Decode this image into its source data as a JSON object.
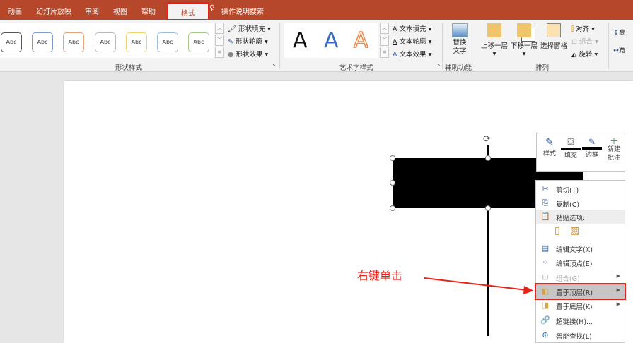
{
  "tabs": [
    "动画",
    "幻灯片放映",
    "审阅",
    "视图",
    "帮助",
    "格式"
  ],
  "tell_me": "操作说明搜索",
  "ribbon": {
    "shape_styles": {
      "gallery": [
        "Abc",
        "Abc",
        "Abc",
        "Abc",
        "Abc",
        "Abc",
        "Abc"
      ],
      "fill": "形状填充",
      "outline": "形状轮廓",
      "effects": "形状效果",
      "label": "形状样式"
    },
    "wordart": {
      "gallery": [
        "A",
        "A",
        "A"
      ],
      "fill": "文本填充",
      "outline": "文本轮廓",
      "effects": "文本效果",
      "label": "艺术字样式"
    },
    "accessibility": {
      "alt_text": "替换文字",
      "label": "辅助功能"
    },
    "arrange": {
      "bring_forward": "上移一层",
      "send_backward": "下移一层",
      "selection_pane": "选择窗格",
      "align": "对齐",
      "group": "组合",
      "rotate": "旋转",
      "label": "排列"
    },
    "size": {
      "height": "高",
      "width": "宽"
    }
  },
  "mini_toolbar": {
    "style": "样式",
    "fill": "填充",
    "outline": "边框",
    "new_comment": "新建批注"
  },
  "context_menu": {
    "cut": "剪切(T)",
    "copy": "复制(C)",
    "paste_options": "粘贴选项:",
    "edit_text": "编辑文字(X)",
    "edit_points": "编辑顶点(E)",
    "group": "组合(G)",
    "bring_to_front": "置于顶层(R)",
    "send_to_back": "置于底层(K)",
    "hyperlink": "超链接(H)...",
    "smart_lookup": "智能查找(L)"
  },
  "annotation": "右键单击",
  "colors": {
    "accent": "#b7472a",
    "highlight": "#e8221a"
  }
}
